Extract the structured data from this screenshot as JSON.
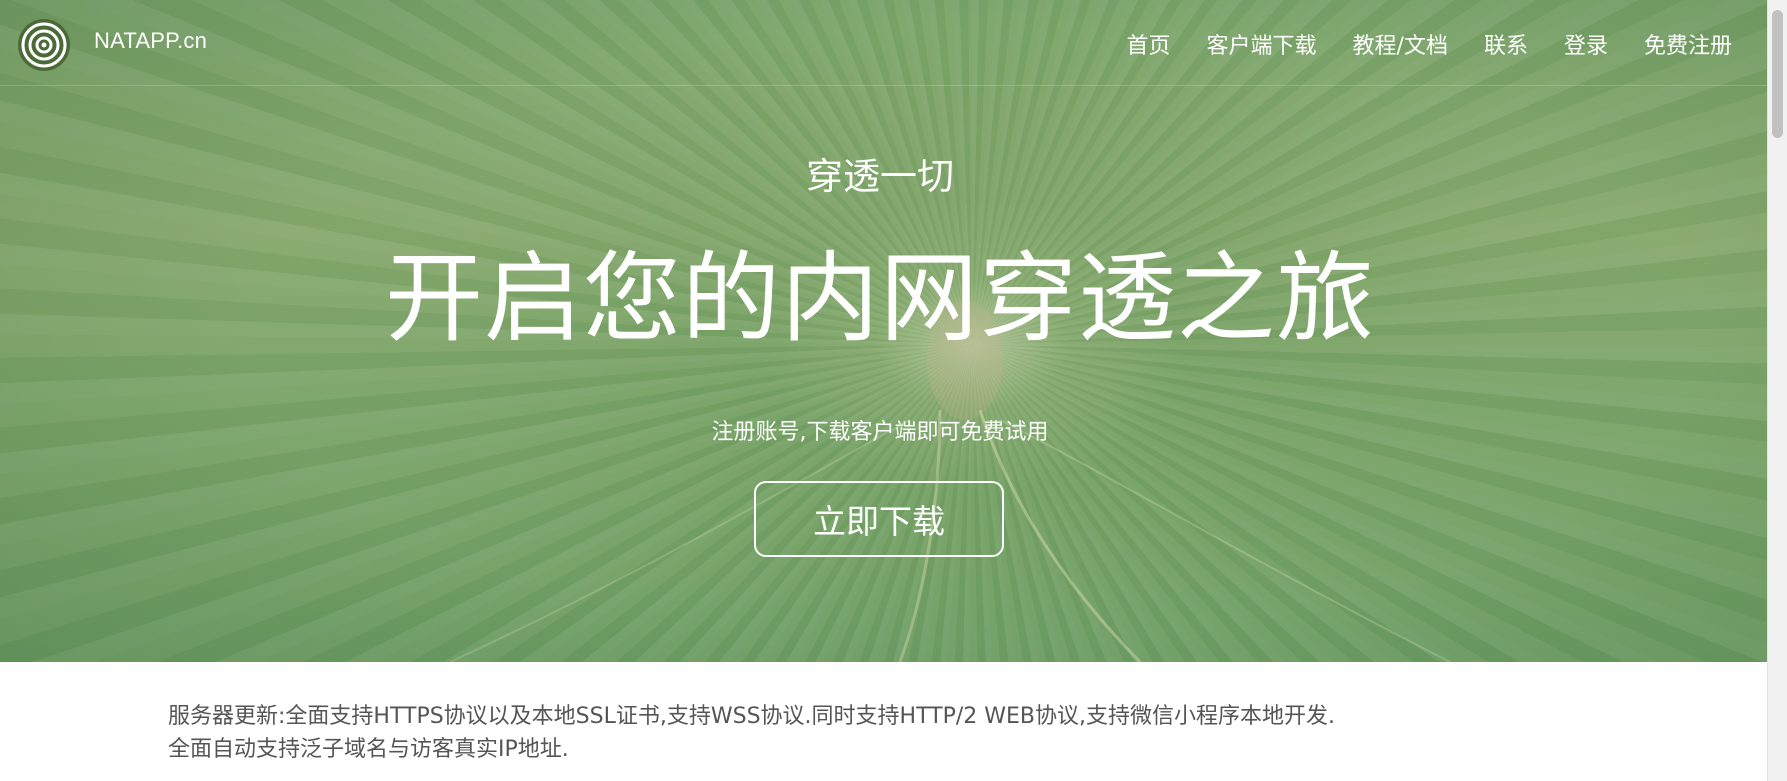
{
  "header": {
    "brand": "NATAPP.cn",
    "logo_icon": "concentric-rings-logo",
    "nav": [
      {
        "label": "首页"
      },
      {
        "label": "客户端下载"
      },
      {
        "label": "教程/文档"
      },
      {
        "label": "联系"
      },
      {
        "label": "登录"
      },
      {
        "label": "免费注册"
      }
    ]
  },
  "hero": {
    "kicker": "穿透一切",
    "headline": "开启您的内网穿透之旅",
    "subtitle": "注册账号,下载客户端即可免费试用",
    "cta_label": "立即下载",
    "tint_color": "#7aa46a"
  },
  "notice": {
    "line1": "服务器更新:全面支持HTTPS协议以及本地SSL证书,支持WSS协议.同时支持HTTP/2 WEB协议,支持微信小程序本地开发.",
    "line2": "全面自动支持泛子域名与访客真实IP地址."
  }
}
